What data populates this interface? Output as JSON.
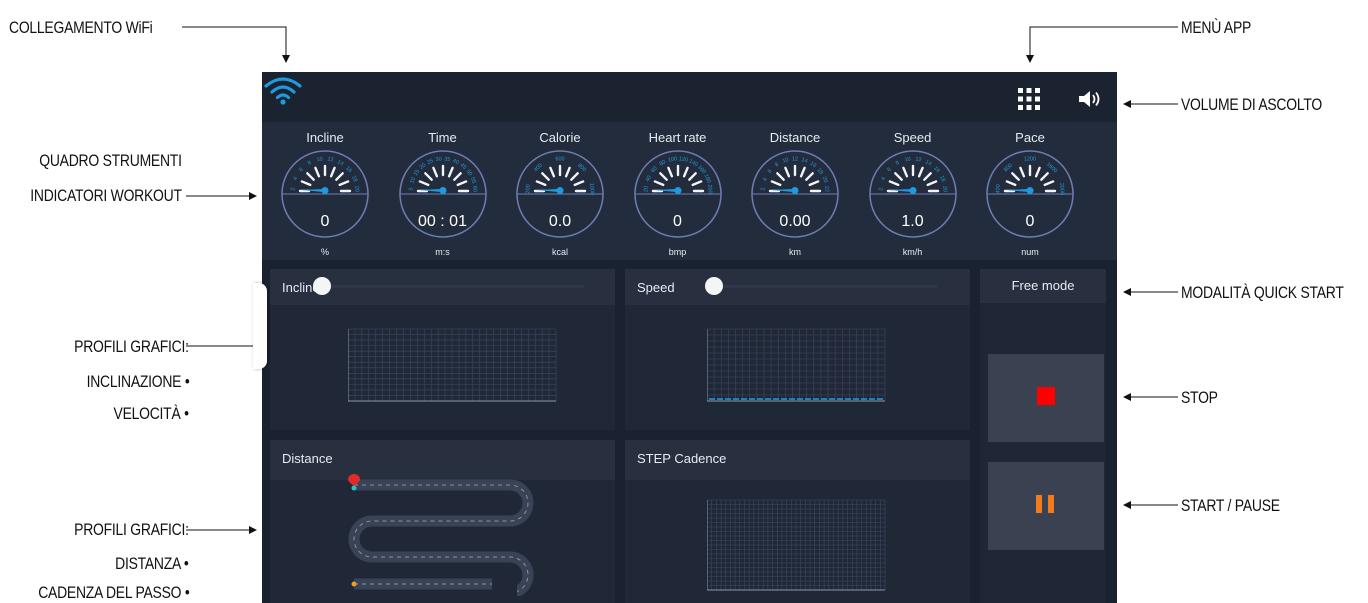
{
  "callouts": {
    "wifi": "COLLEGAMENTO WiFi",
    "menu_app": "MENÙ APP",
    "volume": "VOLUME DI ASCOLTO",
    "gauges_line1": "QUADRO STRUMENTI",
    "gauges_line2": "INDICATORI WORKOUT",
    "quick_start": "MODALITÀ QUICK START",
    "profiles1_line1": "PROFILI GRAFICI:",
    "profiles1_line2": "INCLINAZIONE •",
    "profiles1_line3": "VELOCITÀ •",
    "stop": "STOP",
    "start_pause": "START / PAUSE",
    "profiles2_line1": "PROFILI GRAFICI:",
    "profiles2_line2": "DISTANZA •",
    "profiles2_line3": "CADENZA DEL PASSO •"
  },
  "icons": {
    "wifi": "wifi-icon",
    "apps": "app-grid-icon",
    "volume": "speaker-icon",
    "stop": "stop-icon",
    "pause": "pause-icon",
    "start_marker": "map-pin-icon"
  },
  "colors": {
    "accent": "#1e9be0",
    "screen_bg": "#1a2130",
    "stop": "#ff0000",
    "pause": "#f47a1c"
  },
  "gauges": [
    {
      "label": "Incline",
      "value": "0",
      "unit": "%",
      "scale": [
        "2",
        "4",
        "6",
        "8",
        "10",
        "12",
        "14",
        "16",
        "18",
        "20"
      ]
    },
    {
      "label": "Time",
      "value": "00 : 01",
      "unit": "m:s",
      "scale": [
        "5",
        "10",
        "15",
        "20",
        "25",
        "30",
        "35",
        "40",
        "45",
        "50",
        "55",
        "60"
      ]
    },
    {
      "label": "Calorie",
      "value": "0.0",
      "unit": "kcal",
      "scale": [
        "200",
        "400",
        "600",
        "800",
        "1000"
      ]
    },
    {
      "label": "Heart rate",
      "value": "0",
      "unit": "bmp",
      "scale": [
        "20",
        "40",
        "60",
        "80",
        "100",
        "120",
        "140",
        "160",
        "180",
        "200"
      ]
    },
    {
      "label": "Distance",
      "value": "0.00",
      "unit": "km",
      "scale": [
        "2",
        "4",
        "6",
        "8",
        "10",
        "12",
        "14",
        "16",
        "18",
        "20",
        "22"
      ]
    },
    {
      "label": "Speed",
      "value": "1.0",
      "unit": "km/h",
      "scale": [
        "2",
        "4",
        "6",
        "8",
        "10",
        "12",
        "14",
        "16",
        "18",
        "20"
      ]
    },
    {
      "label": "Pace",
      "value": "0",
      "unit": "num",
      "scale": [
        "400",
        "800",
        "1200",
        "1600",
        "2000"
      ]
    }
  ],
  "panels": {
    "incline": {
      "title": "Incline",
      "slider_value": 0
    },
    "speed": {
      "title": "Speed",
      "slider_value": 0
    },
    "distance": {
      "title": "Distance"
    },
    "cadence": {
      "title": "STEP Cadence"
    }
  },
  "side": {
    "mode": "Free mode"
  }
}
